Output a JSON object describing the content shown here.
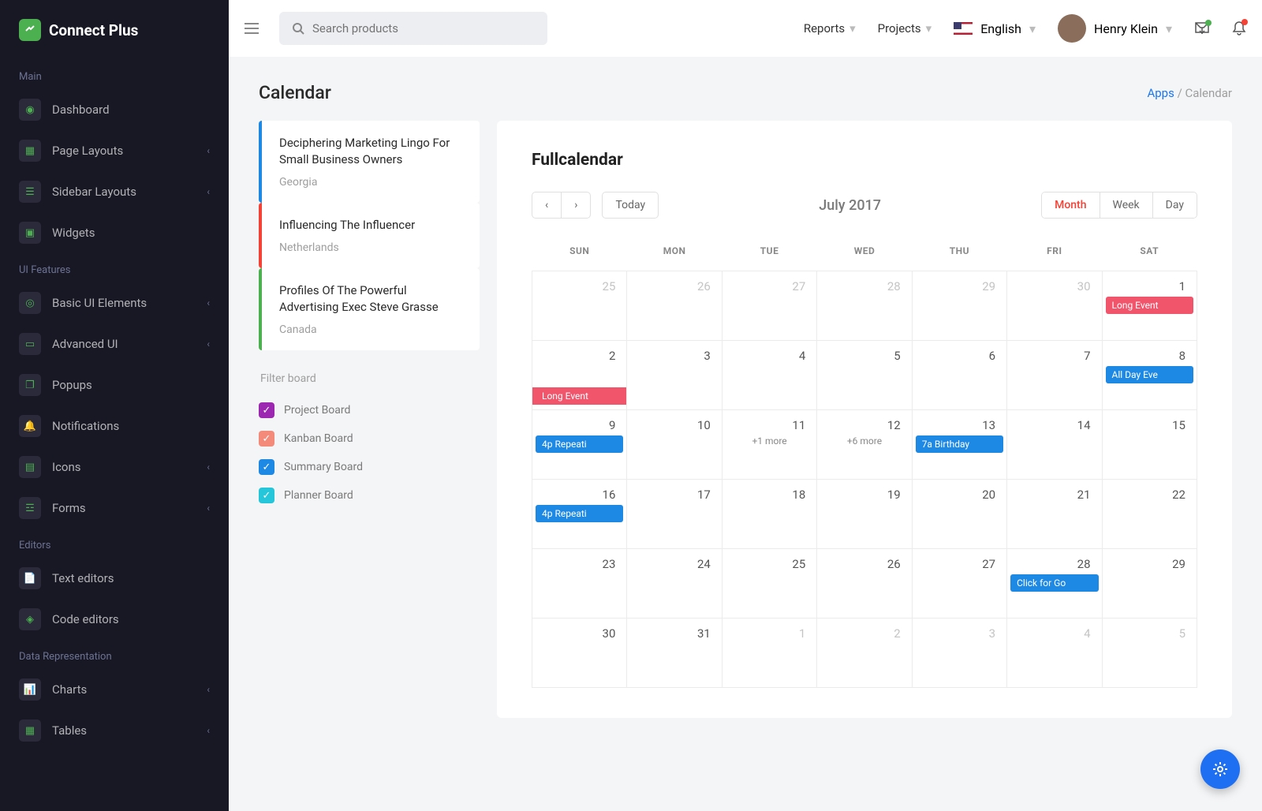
{
  "brand": {
    "name": "Connect Plus"
  },
  "sidebar": {
    "sections": [
      {
        "title": "Main",
        "items": [
          {
            "label": "Dashboard",
            "expandable": false
          },
          {
            "label": "Page Layouts",
            "expandable": true
          },
          {
            "label": "Sidebar Layouts",
            "expandable": true
          },
          {
            "label": "Widgets",
            "expandable": false
          }
        ]
      },
      {
        "title": "UI Features",
        "items": [
          {
            "label": "Basic UI Elements",
            "expandable": true
          },
          {
            "label": "Advanced UI",
            "expandable": true
          },
          {
            "label": "Popups",
            "expandable": false
          },
          {
            "label": "Notifications",
            "expandable": false
          },
          {
            "label": "Icons",
            "expandable": true
          },
          {
            "label": "Forms",
            "expandable": true
          }
        ]
      },
      {
        "title": "Editors",
        "items": [
          {
            "label": "Text editors",
            "expandable": false
          },
          {
            "label": "Code editors",
            "expandable": false
          }
        ]
      },
      {
        "title": "Data Representation",
        "items": [
          {
            "label": "Charts",
            "expandable": true
          },
          {
            "label": "Tables",
            "expandable": true
          }
        ]
      }
    ]
  },
  "topbar": {
    "search_placeholder": "Search products",
    "reports_label": "Reports",
    "projects_label": "Projects",
    "language": "English",
    "user_name": "Henry Klein"
  },
  "page": {
    "title": "Calendar",
    "breadcrumb_root": "Apps",
    "breadcrumb_current": "Calendar"
  },
  "events_list": [
    {
      "title": "Deciphering Marketing Lingo For Small Business Owners",
      "location": "Georgia",
      "color": "blue"
    },
    {
      "title": "Influencing The Influencer",
      "location": "Netherlands",
      "color": "red"
    },
    {
      "title": "Profiles Of The Powerful Advertising Exec Steve Grasse",
      "location": "Canada",
      "color": "green"
    }
  ],
  "filter": {
    "title": "Filter board",
    "items": [
      {
        "label": "Project Board",
        "color": "purple"
      },
      {
        "label": "Kanban Board",
        "color": "salmon"
      },
      {
        "label": "Summary Board",
        "color": "blue"
      },
      {
        "label": "Planner Board",
        "color": "teal"
      }
    ]
  },
  "calendar": {
    "widget_title": "Fullcalendar",
    "today_label": "Today",
    "month_title": "July 2017",
    "views": {
      "month": "Month",
      "week": "Week",
      "day": "Day"
    },
    "day_headers": [
      "SUN",
      "MON",
      "TUE",
      "WED",
      "THU",
      "FRI",
      "SAT"
    ],
    "weeks": [
      {
        "days": [
          {
            "num": "25",
            "other": true
          },
          {
            "num": "26",
            "other": true
          },
          {
            "num": "27",
            "other": true
          },
          {
            "num": "28",
            "other": true
          },
          {
            "num": "29",
            "other": true
          },
          {
            "num": "30",
            "other": true
          },
          {
            "num": "1",
            "events": [
              {
                "text": "Long Event",
                "cls": "red",
                "width": "auto"
              }
            ]
          }
        ]
      },
      {
        "days": [
          {
            "num": "2",
            "longbar": "Long Event"
          },
          {
            "num": "3"
          },
          {
            "num": "4"
          },
          {
            "num": "5"
          },
          {
            "num": "6"
          },
          {
            "num": "7"
          },
          {
            "num": "8",
            "events": [
              {
                "text": "All Day Eve",
                "cls": ""
              }
            ]
          }
        ]
      },
      {
        "days": [
          {
            "num": "9",
            "events": [
              {
                "text": "4p Repeati",
                "cls": ""
              }
            ]
          },
          {
            "num": "10"
          },
          {
            "num": "11",
            "more": "+1 more"
          },
          {
            "num": "12",
            "more": "+6 more"
          },
          {
            "num": "13",
            "events": [
              {
                "text": "7a Birthday",
                "cls": ""
              }
            ]
          },
          {
            "num": "14"
          },
          {
            "num": "15"
          }
        ]
      },
      {
        "days": [
          {
            "num": "16",
            "events": [
              {
                "text": "4p Repeati",
                "cls": ""
              }
            ]
          },
          {
            "num": "17"
          },
          {
            "num": "18"
          },
          {
            "num": "19"
          },
          {
            "num": "20"
          },
          {
            "num": "21"
          },
          {
            "num": "22"
          }
        ]
      },
      {
        "days": [
          {
            "num": "23"
          },
          {
            "num": "24"
          },
          {
            "num": "25"
          },
          {
            "num": "26"
          },
          {
            "num": "27"
          },
          {
            "num": "28",
            "events": [
              {
                "text": "Click for Go",
                "cls": ""
              }
            ]
          },
          {
            "num": "29"
          }
        ]
      },
      {
        "days": [
          {
            "num": "30"
          },
          {
            "num": "31"
          },
          {
            "num": "1",
            "other": true
          },
          {
            "num": "2",
            "other": true
          },
          {
            "num": "3",
            "other": true
          },
          {
            "num": "4",
            "other": true
          },
          {
            "num": "5",
            "other": true
          }
        ]
      }
    ]
  }
}
